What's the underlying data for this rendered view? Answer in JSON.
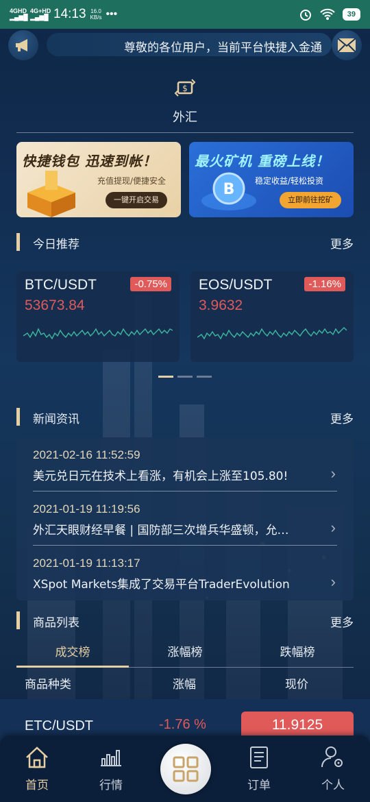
{
  "status_bar": {
    "network_1": "4GHD",
    "network_2": "4G+HD",
    "time": "14:13",
    "speed_value": "16.0",
    "speed_unit": "KB/s",
    "dots": "•••",
    "battery": "39"
  },
  "notice": {
    "text": "尊敬的各位用户，当前平台快捷入金通"
  },
  "category": {
    "label": "外汇"
  },
  "banners": [
    {
      "title": "快捷钱包  迅速到帐！",
      "subtitle": "充值提现/便捷安全",
      "button": "一键开启交易"
    },
    {
      "title": "最火矿机  重磅上线！",
      "subtitle": "稳定收益/轻松投资",
      "button": "立即前往挖矿"
    }
  ],
  "recommend": {
    "title": "今日推荐",
    "more": "更多",
    "cards": [
      {
        "symbol": "BTC/USDT",
        "change": "-0.75%",
        "price": "53673.84"
      },
      {
        "symbol": "EOS/USDT",
        "change": "-1.16%",
        "price": "3.9632"
      }
    ],
    "active_page": 1,
    "page_count": 3
  },
  "news": {
    "title": "新闻资讯",
    "more": "更多",
    "items": [
      {
        "time": "2021-02-16 11:52:59",
        "title": "美元兑日元在技术上看涨，有机会上涨至105.80!"
      },
      {
        "time": "2021-01-19 11:19:56",
        "title": "外汇天眼财经早餐 | 国防部三次增兵华盛顿，允…"
      },
      {
        "time": "2021-01-19 11:13:17",
        "title": "XSpot Markets集成了交易平台TraderEvolution"
      }
    ]
  },
  "products": {
    "title": "商品列表",
    "more": "更多",
    "tabs": [
      "成交榜",
      "涨幅榜",
      "跌幅榜"
    ],
    "active_tab": 0,
    "columns": [
      "商品种类",
      "涨幅",
      "现价"
    ],
    "rows": [
      {
        "symbol": "ETC/USDT",
        "change": "-1.76 %",
        "price": "11.9125"
      }
    ]
  },
  "bottom_nav": {
    "items": [
      "首页",
      "行情",
      "订单",
      "个人"
    ],
    "active": 0
  },
  "colors": {
    "accent_gold": "#e6cfa3",
    "down_red": "#e05a5a",
    "status_green": "#1f6f5e"
  }
}
